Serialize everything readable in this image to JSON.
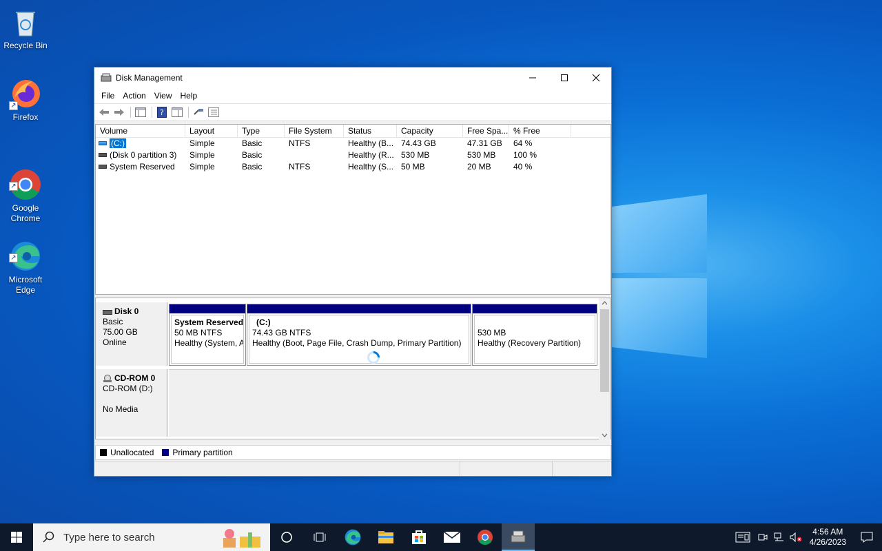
{
  "desktop": {
    "icons": [
      {
        "label": "Recycle Bin",
        "icon": "recycle-bin-icon"
      },
      {
        "label": "Firefox",
        "icon": "firefox-icon"
      },
      {
        "label": "Google\nChrome",
        "icon": "chrome-icon"
      },
      {
        "label": "Microsoft\nEdge",
        "icon": "edge-icon"
      }
    ]
  },
  "window": {
    "title": "Disk Management",
    "menu": [
      "File",
      "Action",
      "View",
      "Help"
    ],
    "columns": [
      "Volume",
      "Layout",
      "Type",
      "File System",
      "Status",
      "Capacity",
      "Free Spa...",
      "% Free"
    ],
    "volumes": [
      {
        "volume": "(C:)",
        "layout": "Simple",
        "type": "Basic",
        "fs": "NTFS",
        "status": "Healthy (B...",
        "capacity": "74.43 GB",
        "free": "47.31 GB",
        "pct": "64 %",
        "selected": true
      },
      {
        "volume": "(Disk 0 partition 3)",
        "layout": "Simple",
        "type": "Basic",
        "fs": "",
        "status": "Healthy (R...",
        "capacity": "530 MB",
        "free": "530 MB",
        "pct": "100 %"
      },
      {
        "volume": "System Reserved",
        "layout": "Simple",
        "type": "Basic",
        "fs": "NTFS",
        "status": "Healthy (S...",
        "capacity": "50 MB",
        "free": "20 MB",
        "pct": "40 %"
      }
    ],
    "disks": [
      {
        "name": "Disk 0",
        "kind": "Basic",
        "size": "75.00 GB",
        "state": "Online",
        "partitions": [
          {
            "title": "System Reserved",
            "size": "50 MB NTFS",
            "status": "Healthy (System, A"
          },
          {
            "title": "(C:)",
            "size": "74.43 GB NTFS",
            "status": "Healthy (Boot, Page File, Crash Dump, Primary Partition)"
          },
          {
            "title": "",
            "size": "530 MB",
            "status": "Healthy (Recovery Partition)"
          }
        ]
      },
      {
        "name": "CD-ROM 0",
        "kind": "CD-ROM (D:)",
        "size": "",
        "state": "No Media"
      }
    ],
    "legend": [
      {
        "label": "Unallocated",
        "color": "#000000"
      },
      {
        "label": "Primary partition",
        "color": "#00007f"
      }
    ]
  },
  "taskbar": {
    "search_placeholder": "Type here to search",
    "time": "4:56 AM",
    "date": "4/26/2023"
  }
}
